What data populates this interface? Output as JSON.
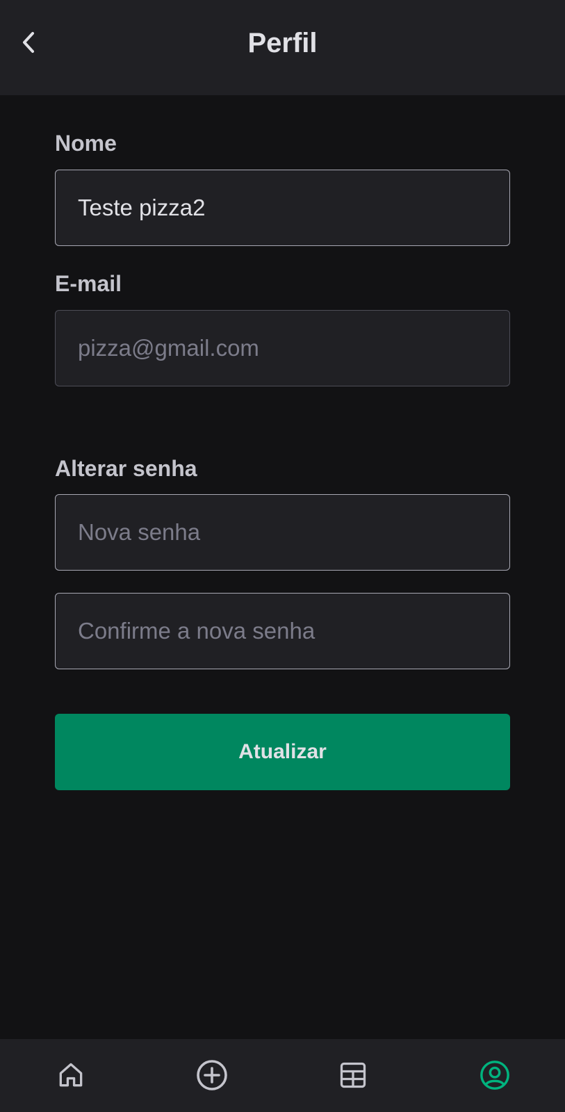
{
  "header": {
    "title": "Perfil",
    "back_icon": "chevron-left-icon"
  },
  "form": {
    "name_label": "Nome",
    "name_value": "Teste pizza2",
    "email_label": "E-mail",
    "email_placeholder": "pizza@gmail.com",
    "password_section_label": "Alterar senha",
    "new_password_placeholder": "Nova senha",
    "confirm_password_placeholder": "Confirme a nova senha",
    "submit_label": "Atualizar"
  },
  "bottom_nav": {
    "items": [
      {
        "icon": "home-icon",
        "active": false
      },
      {
        "icon": "plus-circle-icon",
        "active": false
      },
      {
        "icon": "table-icon",
        "active": false
      },
      {
        "icon": "user-circle-icon",
        "active": true
      }
    ]
  },
  "colors": {
    "background": "#121214",
    "surface": "#202024",
    "accent": "#00875F",
    "active_icon": "#00B37E",
    "icon": "#C4C4CC"
  }
}
